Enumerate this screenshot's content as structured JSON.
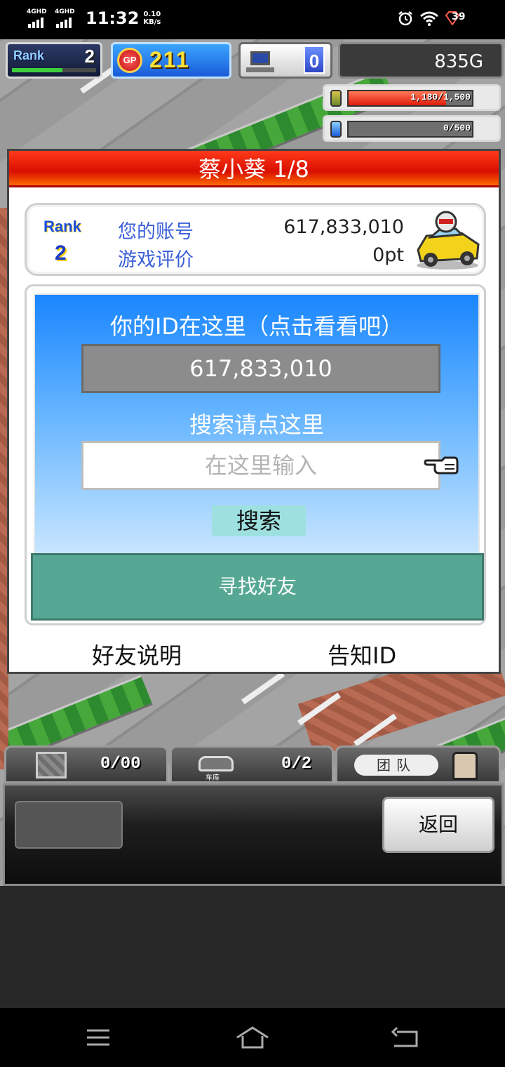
{
  "status": {
    "signal1": "4GHD",
    "signal2": "4GHD",
    "time": "11:32",
    "speed_value": "0.10",
    "speed_unit": "KB/s",
    "battery": "39"
  },
  "hud": {
    "rank_label": "Rank",
    "rank_value": "2",
    "rank_progress": 0.6,
    "gp_icon": "GP",
    "gp_value": "211",
    "computer_count": "0",
    "money": "835G",
    "resource1_text": "1,180/1,500",
    "resource1_fill": 0.79,
    "resource2_text": "0/500",
    "resource2_fill": 0.0
  },
  "dialog": {
    "title": "蔡小葵 1/8",
    "rank_label": "Rank",
    "rank_value": "2",
    "account_label": "您的账号",
    "account_value": "617,833,010",
    "rating_label": "游戏评价",
    "rating_value": "0pt",
    "id_hint": "你的ID在这里（点击看看吧）",
    "id_value": "617,833,010",
    "search_hint": "搜索请点这里",
    "search_placeholder": "在这里输入",
    "search_button": "搜索",
    "find_friend_button": "寻找好友",
    "friend_help": "好友说明",
    "notify_id": "告知ID"
  },
  "toolbar": {
    "garage_count": "0/00",
    "garage_label": "车库",
    "car_count": "0/2",
    "team_label": "团队",
    "back_button": "返回"
  }
}
